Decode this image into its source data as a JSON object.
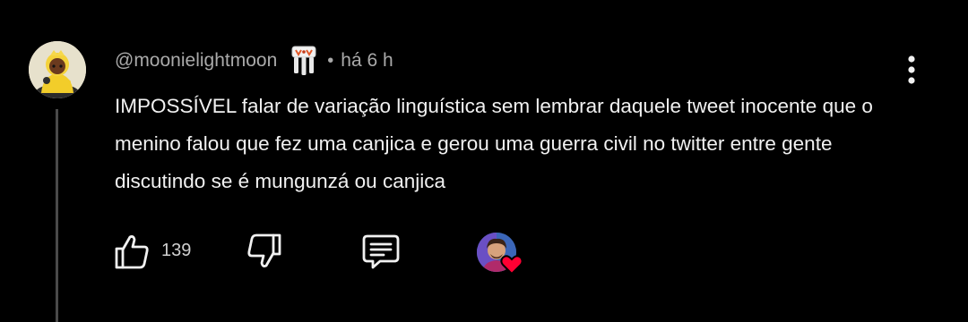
{
  "comment": {
    "author": "@moonielightmoon",
    "separator": "•",
    "timestamp": "há 6 h",
    "text": "IMPOSSÍVEL falar de variação linguística sem lembrar daquele tweet inocente que o menino falou que fez uma canjica e gerou uma guerra civil no twitter entre gente discutindo se é mungunzá ou canjica",
    "like_count": "139",
    "icons": {
      "avatar": "user-avatar",
      "badge": "membership-badge-icon",
      "more": "more-vert-icon",
      "like": "thumbs-up-icon",
      "dislike": "thumbs-down-icon",
      "reply": "reply-icon",
      "creator_heart": "creator-heart-icon"
    }
  },
  "colors": {
    "background": "#000000",
    "text_primary": "#f1f1f1",
    "text_secondary": "#aaaaaa",
    "thread_line": "#4a4a4a",
    "heart": "#ff0033"
  }
}
